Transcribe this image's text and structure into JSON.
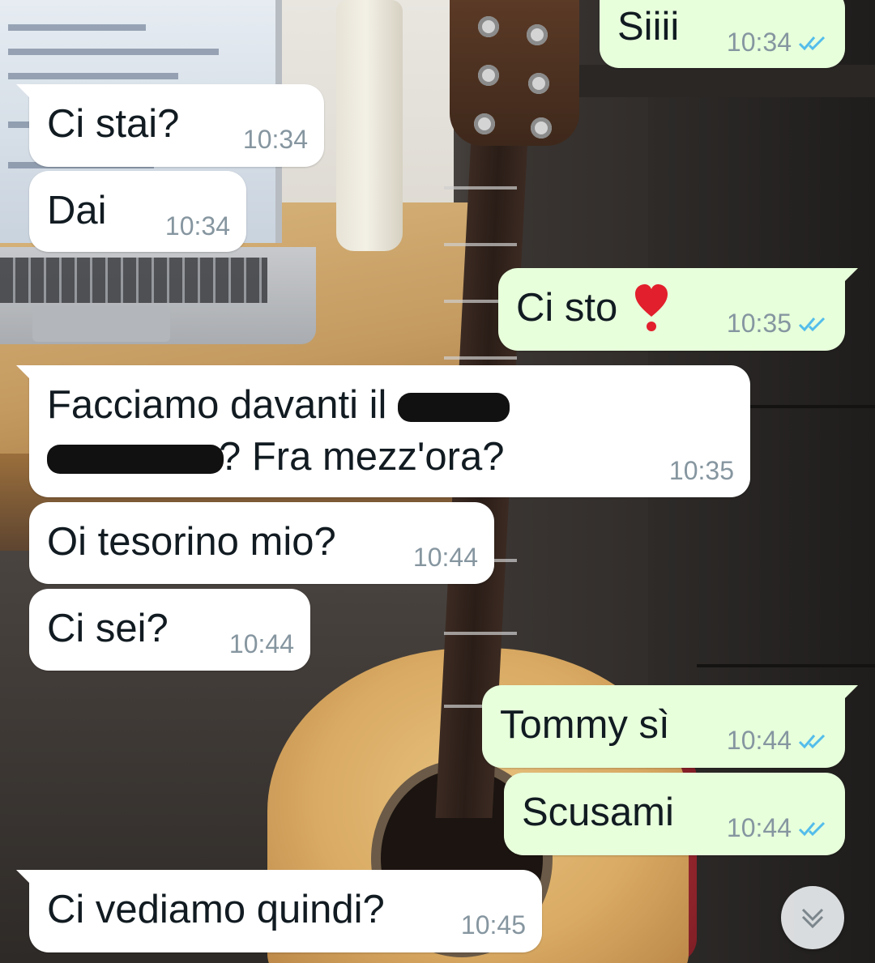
{
  "messages": [
    {
      "id": "m1",
      "direction": "outgoing",
      "text": "Siiii",
      "time": "10:34",
      "status": "read"
    },
    {
      "id": "m2",
      "direction": "incoming",
      "text": "Ci stai?",
      "time": "10:34"
    },
    {
      "id": "m3",
      "direction": "incoming",
      "text": "Dai",
      "time": "10:34"
    },
    {
      "id": "m4",
      "direction": "outgoing",
      "text": "Ci sto",
      "emoji": "heart",
      "time": "10:35",
      "status": "read"
    },
    {
      "id": "m5",
      "direction": "incoming",
      "text_line1": "Facciamo davanti il",
      "text_line2": "? Fra mezz'ora?",
      "redacted": true,
      "time": "10:35"
    },
    {
      "id": "m6",
      "direction": "incoming",
      "text": "Oi tesorino mio?",
      "time": "10:44"
    },
    {
      "id": "m7",
      "direction": "incoming",
      "text": "Ci sei?",
      "time": "10:44"
    },
    {
      "id": "m8",
      "direction": "outgoing",
      "text": "Tommy sì",
      "time": "10:44",
      "status": "read"
    },
    {
      "id": "m9",
      "direction": "outgoing",
      "text": "Scusami",
      "time": "10:44",
      "status": "read"
    },
    {
      "id": "m10",
      "direction": "incoming",
      "text": "Ci vediamo quindi?",
      "time": "10:45"
    }
  ],
  "colors": {
    "incoming_bubble": "#ffffff",
    "outgoing_bubble": "#e7ffdb",
    "read_tick": "#53bdeb",
    "timestamp": "#8696a0"
  },
  "icons": {
    "read_receipt": "double-check-icon",
    "scroll_down": "chevron-double-down-icon",
    "emoji": "heart-emoji-icon"
  }
}
